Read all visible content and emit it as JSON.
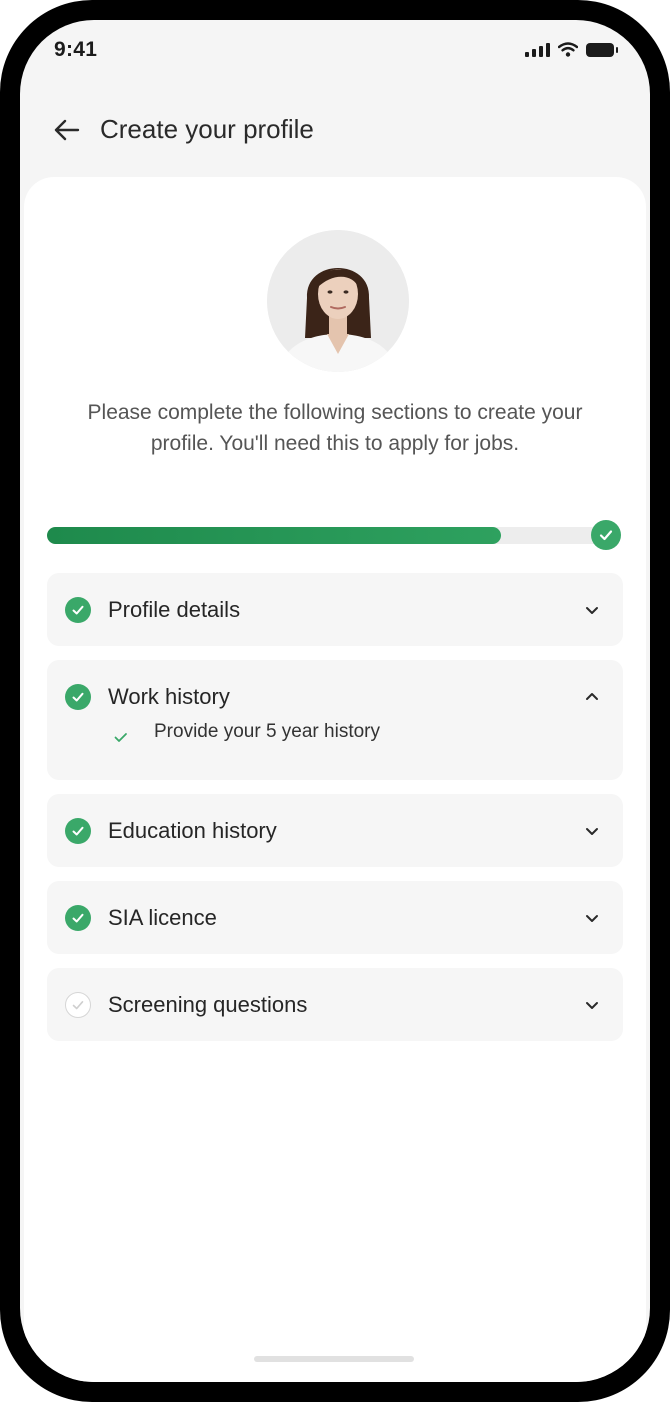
{
  "status_bar": {
    "time": "9:41",
    "icons": [
      "signal-icon",
      "wifi-icon",
      "battery-icon"
    ]
  },
  "header": {
    "title": "Create your profile",
    "back_icon": "arrow-left-icon"
  },
  "profile": {
    "avatar": "profile-photo"
  },
  "intro_text": "Please complete the following sections to create your profile. You'll need this to apply for jobs.",
  "progress": {
    "value": 0.81,
    "complete_icon": "check-circle-icon"
  },
  "sections": [
    {
      "label": "Profile details",
      "status": "complete",
      "expanded": false
    },
    {
      "label": "Work history",
      "status": "complete",
      "expanded": true,
      "items": [
        {
          "label": "Provide your 5 year history",
          "status": "complete"
        }
      ]
    },
    {
      "label": "Education history",
      "status": "complete",
      "expanded": false
    },
    {
      "label": "SIA licence",
      "status": "complete",
      "expanded": false
    },
    {
      "label": "Screening questions",
      "status": "pending",
      "expanded": false
    }
  ],
  "colors": {
    "accent": "#3aa869",
    "progress_fill": "#1e8a4c",
    "section_bg": "#f6f6f6",
    "page_bg": "#f5f5f5"
  }
}
